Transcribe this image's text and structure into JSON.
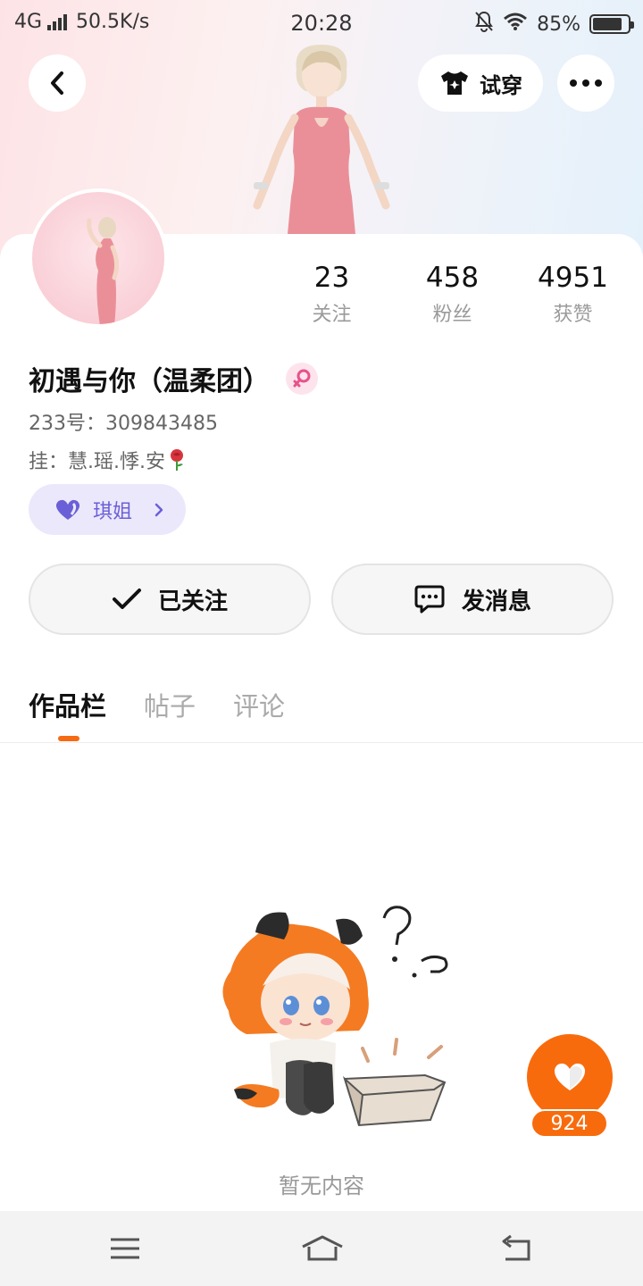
{
  "status_bar": {
    "network": "4G",
    "speed": "50.5K/s",
    "time": "20:28",
    "battery": "85%",
    "battery_level": 0.85
  },
  "header": {
    "try_on_label": "试穿"
  },
  "profile": {
    "nickname": "初遇与你（温柔团）",
    "uid": "233号：309843485",
    "signature": "挂：慧.瑶.悸.安",
    "tag_label": "琪姐"
  },
  "stats": [
    {
      "value": "23",
      "label": "关注"
    },
    {
      "value": "458",
      "label": "粉丝"
    },
    {
      "value": "4951",
      "label": "获赞"
    }
  ],
  "actions": {
    "follow_label": "已关注",
    "message_label": "发消息"
  },
  "tabs": [
    {
      "label": "作品栏",
      "active": true
    },
    {
      "label": "帖子",
      "active": false
    },
    {
      "label": "评论",
      "active": false
    }
  ],
  "empty_state": {
    "text": "暂无内容"
  },
  "like": {
    "count": "924"
  },
  "colors": {
    "accent": "#f86b0c",
    "tag_text": "#6b5fd8",
    "tag_bg": "#ebe8fb",
    "gender_female": "#e8528a"
  },
  "icons": {
    "back": "chevron-left-icon",
    "try_on": "tshirt-icon",
    "more": "more-dots-icon",
    "gender": "female-icon",
    "tag": "heart-icon",
    "follow": "check-icon",
    "message": "chat-bubble-icon",
    "like": "heart-icon",
    "nav": [
      "menu-icon",
      "home-icon",
      "back-icon"
    ]
  }
}
